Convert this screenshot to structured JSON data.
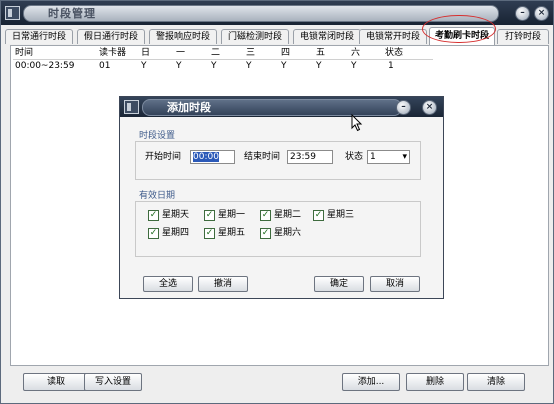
{
  "window": {
    "title": "时段管理"
  },
  "tabs": [
    {
      "label": "日常通行时段"
    },
    {
      "label": "假日通行时段"
    },
    {
      "label": "警报响应时段"
    },
    {
      "label": "门磁检测时段"
    },
    {
      "label": "电锁常闭时段"
    },
    {
      "label": "电锁常开时段"
    },
    {
      "label": "考勤刷卡时段"
    },
    {
      "label": "打铃时段"
    }
  ],
  "active_tab": "考勤刷卡时段",
  "table": {
    "columns": [
      "时间",
      "读卡器",
      "日",
      "一",
      "二",
      "三",
      "四",
      "五",
      "六",
      "状态"
    ],
    "rows": [
      [
        "00:00~23:59",
        "01",
        "Y",
        "Y",
        "Y",
        "Y",
        "Y",
        "Y",
        "Y",
        "1"
      ]
    ]
  },
  "buttons": {
    "read": "读取",
    "write": "写入设置",
    "add": "添加...",
    "delete": "删除",
    "clear": "清除"
  },
  "dialog": {
    "title": "添加时段",
    "period_group": "时段设置",
    "start_label": "开始时间",
    "start_value": "00:00",
    "end_label": "结束时间",
    "end_value": "23:59",
    "status_label": "状态",
    "status_value": "1",
    "dates_group": "有效日期",
    "days": [
      {
        "label": "星期天",
        "checked": true
      },
      {
        "label": "星期一",
        "checked": true
      },
      {
        "label": "星期二",
        "checked": true
      },
      {
        "label": "星期三",
        "checked": true
      },
      {
        "label": "星期四",
        "checked": true
      },
      {
        "label": "星期五",
        "checked": true
      },
      {
        "label": "星期六",
        "checked": true
      }
    ],
    "select_all": "全选",
    "undo": "撤消",
    "ok": "确定",
    "cancel": "取消"
  },
  "colors": {
    "highlight_ring": "#d63030",
    "selection": "#2b59b8"
  }
}
